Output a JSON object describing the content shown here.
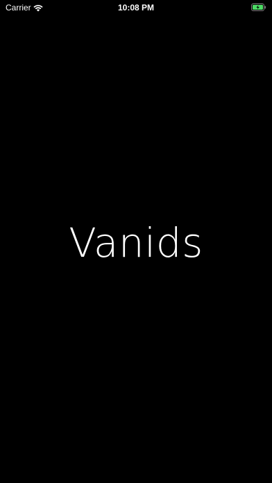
{
  "status_bar": {
    "carrier": "Carrier",
    "time": "10:08 PM",
    "wifi_icon": "wifi-icon",
    "battery_icon": "battery-charging-icon",
    "battery_color": "#4cd964"
  },
  "splash": {
    "title": "Vanids",
    "background_color": "#000000",
    "text_color": "#ffffff"
  }
}
